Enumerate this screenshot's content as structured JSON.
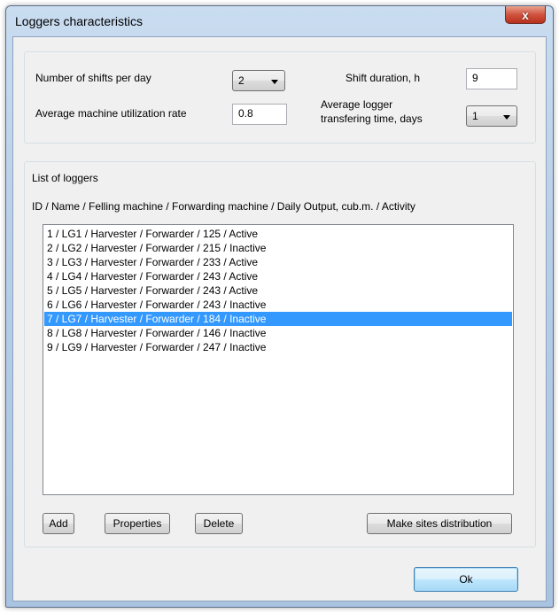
{
  "window": {
    "title": "Loggers characteristics",
    "close_glyph": "x"
  },
  "settings": {
    "shifts_label": "Number of shifts per day",
    "shifts_value": "2",
    "duration_label": "Shift duration, h",
    "duration_value": "9",
    "utilization_label": "Average machine utilization rate",
    "utilization_value": "0.8",
    "transfer_label_line1": "Average logger",
    "transfer_label_line2": "transfering time, days",
    "transfer_value": "1"
  },
  "loggers": {
    "group_title": "List of loggers",
    "columns_header": "ID / Name / Felling machine / Forwarding machine / Daily Output, cub.m. / Activity",
    "items": [
      "1 / LG1 / Harvester / Forwarder / 125 / Active",
      "2 / LG2 / Harvester / Forwarder / 215 / Inactive",
      "3 / LG3 / Harvester / Forwarder / 233 / Active",
      "4 / LG4 / Harvester / Forwarder / 243 / Active",
      "5 / LG5 / Harvester / Forwarder / 243 / Active",
      "6 / LG6 / Harvester / Forwarder / 243 / Inactive",
      "7 / LG7 / Harvester / Forwarder / 184 / Inactive",
      "8 / LG8 / Harvester / Forwarder / 146 / Inactive",
      "9 / LG9 / Harvester / Forwarder / 247 / Inactive"
    ],
    "selected_index": 6
  },
  "buttons": {
    "add": "Add",
    "properties": "Properties",
    "delete": "Delete",
    "distribute": "Make sites distribution",
    "ok": "Ok"
  },
  "colors": {
    "selection": "#3399ff",
    "close_button": "#c9462c"
  }
}
